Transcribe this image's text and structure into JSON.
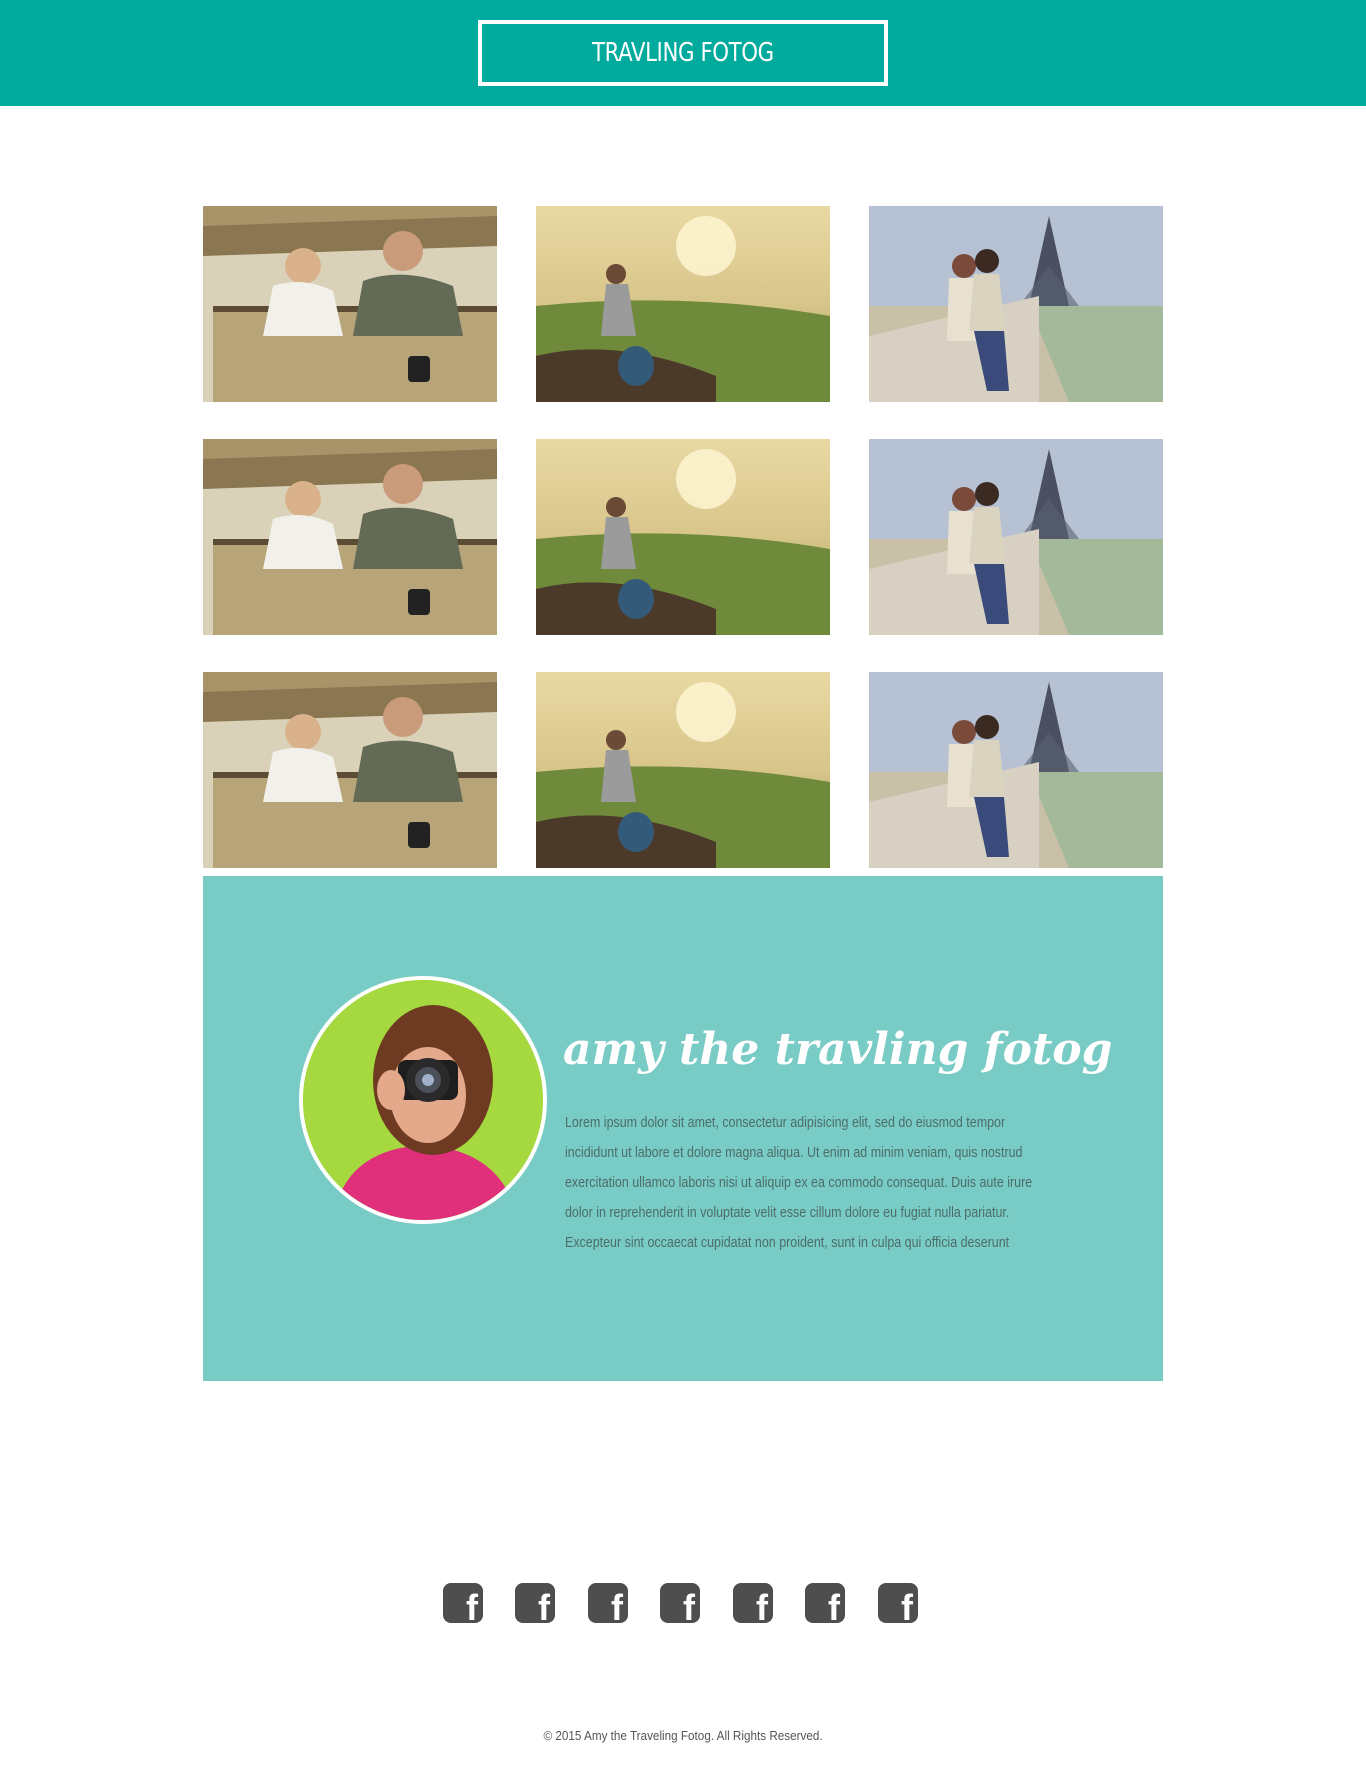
{
  "header": {
    "title": "TRAVLING FOTOG"
  },
  "gallery": {
    "photos": [
      {
        "subject": "safari-couple-binoculars"
      },
      {
        "subject": "woman-sitting-on-cliff-at-sunset"
      },
      {
        "subject": "couple-near-eiffel-tower"
      },
      {
        "subject": "safari-couple-binoculars"
      },
      {
        "subject": "woman-sitting-on-cliff-at-sunset"
      },
      {
        "subject": "couple-near-eiffel-tower"
      },
      {
        "subject": "safari-couple-binoculars"
      },
      {
        "subject": "woman-sitting-on-cliff-at-sunset"
      },
      {
        "subject": "couple-near-eiffel-tower"
      }
    ]
  },
  "about": {
    "title": "amy the travling fotog",
    "body": "Lorem ipsum dolor sit amet, consectetur adipisicing elit, sed do eiusmod tempor incididunt ut labore et dolore magna aliqua. Ut enim ad minim veniam, quis nostrud exercitation ullamco laboris nisi ut aliquip ex ea commodo consequat. Duis aute irure dolor in reprehenderit in voluptate velit esse cillum dolore eu fugiat nulla pariatur. Excepteur sint occaecat cupidatat non proident, sunt in culpa qui officia deserunt"
  },
  "social": {
    "icons": [
      "facebook-icon",
      "facebook-icon",
      "facebook-icon",
      "facebook-icon",
      "facebook-icon",
      "facebook-icon",
      "facebook-icon"
    ],
    "glyph": "f"
  },
  "footer": {
    "copyright": "© 2015 Amy the Traveling Fotog. All Rights Reserved."
  },
  "colors": {
    "header_bg": "#00aa9d",
    "about_bg": "#79cbc5",
    "icon_bg": "#4e4e4e",
    "text": "#555555"
  }
}
